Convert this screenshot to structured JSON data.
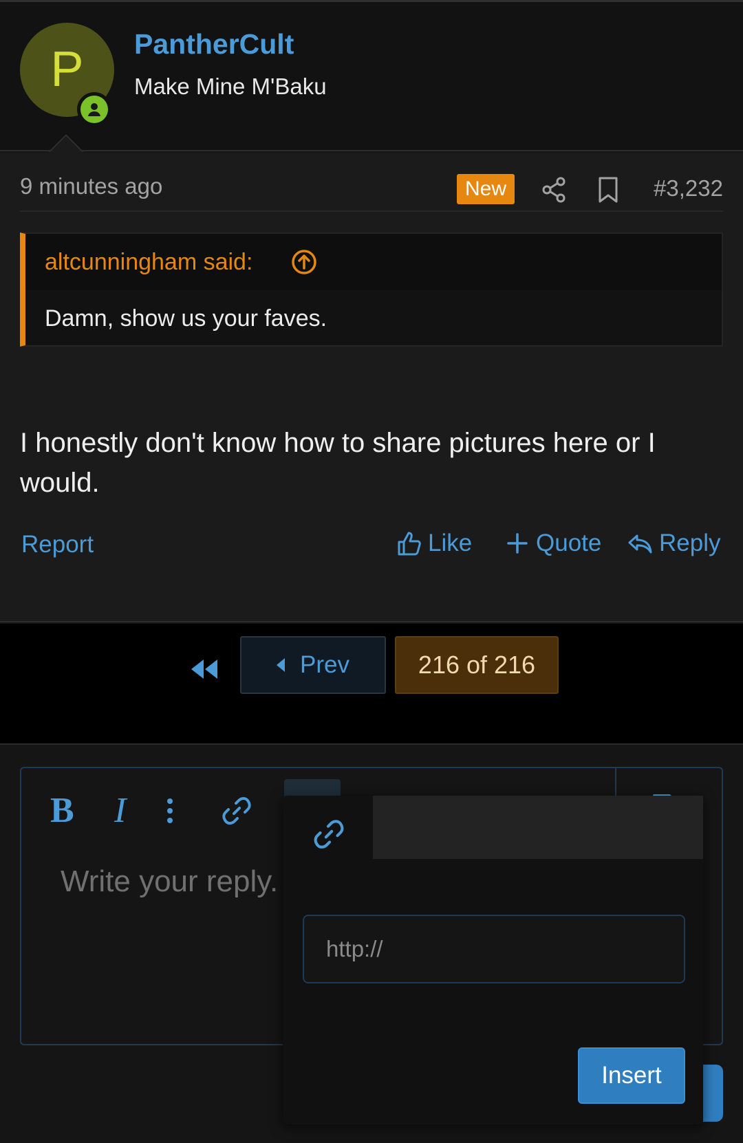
{
  "post_header": {
    "avatar_letter": "P",
    "username": "PantherCult",
    "user_title": "Make Mine M'Baku"
  },
  "post": {
    "time": "9 minutes ago",
    "new_badge": "New",
    "post_number": "#3,232",
    "quote": {
      "author_line": "altcunningham said:",
      "text": "Damn, show us your faves."
    },
    "body": "I honestly don't know how to share pictures here or I would.",
    "actions": {
      "report": "Report",
      "like": "Like",
      "quote": "Quote",
      "reply": "Reply"
    }
  },
  "pagination": {
    "prev_label": "Prev",
    "page_indicator": "216 of 216"
  },
  "editor": {
    "placeholder": "Write your reply.",
    "insert_popup": {
      "url_placeholder": "http://",
      "insert_label": "Insert"
    }
  },
  "colors": {
    "accent_blue": "#4a9bd8",
    "accent_orange": "#e6870f",
    "online_green": "#7bc12a"
  },
  "icons": [
    "share-icon",
    "bookmark-icon",
    "arrow-up-circle-icon",
    "thumbs-up-icon",
    "plus-icon",
    "reply-icon",
    "double-chevron-left-icon",
    "bold-icon",
    "italic-icon",
    "more-vertical-icon",
    "link-icon",
    "image-icon",
    "undo-icon",
    "preview-icon"
  ]
}
